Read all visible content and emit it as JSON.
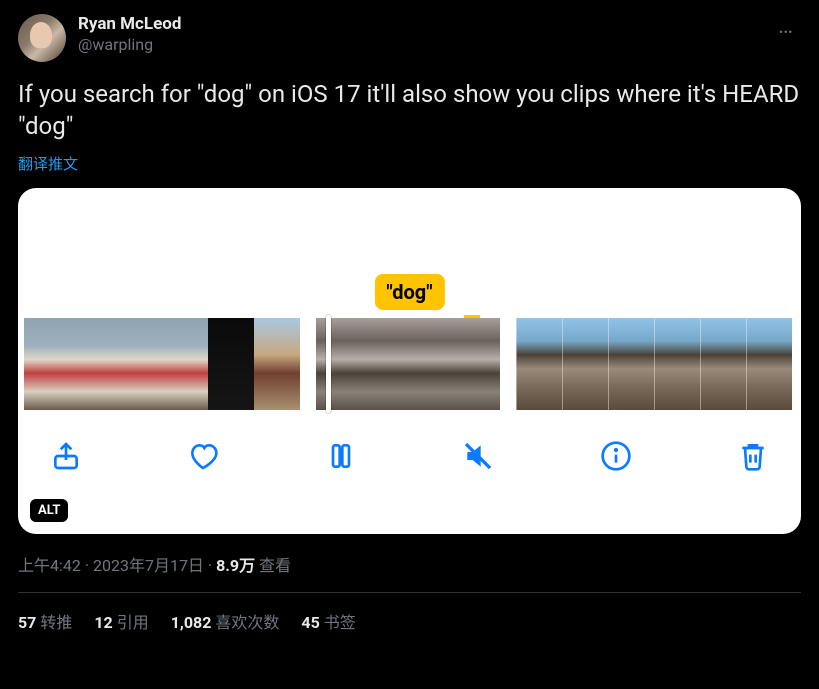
{
  "author": {
    "display_name": "Ryan McLeod",
    "handle": "@warpling"
  },
  "more_glyph": "…",
  "tweet_text": "If you search for \"dog\" on iOS 17 it'll also show you clips where it's HEARD \"dog\"",
  "translate_label": "翻译推文",
  "media": {
    "chip_label": "\"dog\"",
    "alt_badge": "ALT",
    "controls": {
      "share": "share-icon",
      "like": "heart-icon",
      "pause": "pause-icon",
      "mute": "mute-icon",
      "info": "info-icon",
      "delete": "trash-icon"
    }
  },
  "meta": {
    "time": "上午4:42",
    "dot1": " · ",
    "date": "2023年7月17日",
    "dot2": " · ",
    "views_number": "8.9万",
    "views_label": " 查看"
  },
  "stats": {
    "retweets": {
      "num": "57",
      "label": "转推"
    },
    "quotes": {
      "num": "12",
      "label": "引用"
    },
    "likes": {
      "num": "1,082",
      "label": "喜欢次数"
    },
    "bookmarks": {
      "num": "45",
      "label": "书签"
    }
  }
}
